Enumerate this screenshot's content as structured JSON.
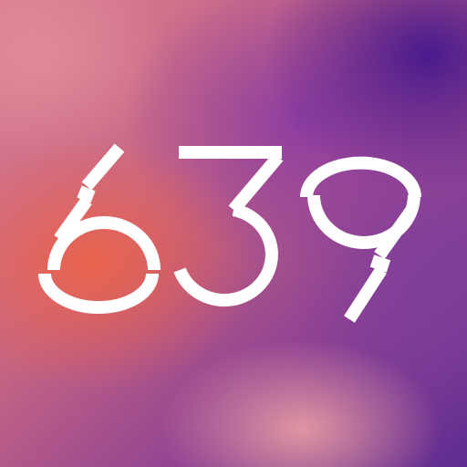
{
  "number": "639",
  "colors": {
    "text": "#ffffff",
    "bg_coral": "#eb5f46",
    "bg_purple": "#461987",
    "bg_pink": "#d9788c"
  }
}
